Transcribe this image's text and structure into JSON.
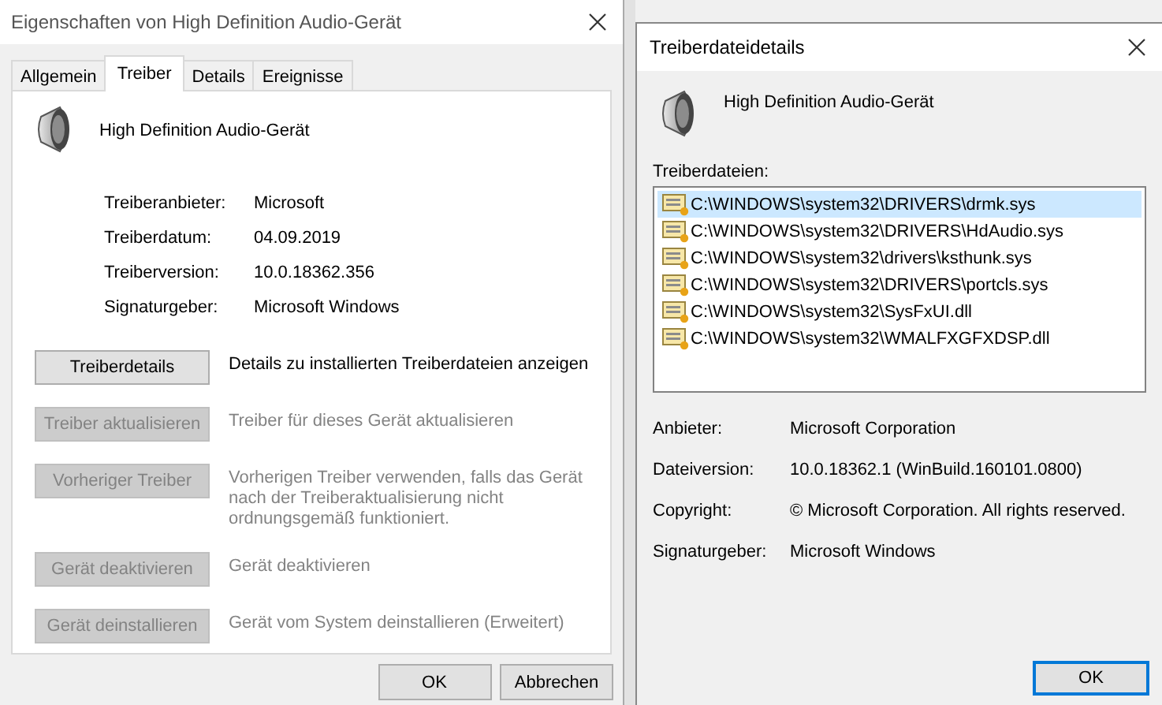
{
  "properties_dialog": {
    "title": "Eigenschaften von High Definition Audio-Gerät",
    "tabs": [
      {
        "label": "Allgemein",
        "selected": false
      },
      {
        "label": "Treiber",
        "selected": true
      },
      {
        "label": "Details",
        "selected": false
      },
      {
        "label": "Ereignisse",
        "selected": false
      }
    ],
    "device_name": "High Definition Audio-Gerät",
    "info": [
      {
        "label": "Treiberanbieter:",
        "value": "Microsoft"
      },
      {
        "label": "Treiberdatum:",
        "value": "04.09.2019"
      },
      {
        "label": "Treiberversion:",
        "value": "10.0.18362.356"
      },
      {
        "label": "Signaturgeber:",
        "value": "Microsoft Windows"
      }
    ],
    "actions": [
      {
        "button": "Treiberdetails",
        "description": "Details zu installierten Treiberdateien anzeigen",
        "disabled": false
      },
      {
        "button": "Treiber aktualisieren",
        "description": "Treiber für dieses Gerät aktualisieren",
        "disabled": true
      },
      {
        "button": "Vorheriger Treiber",
        "description": "Vorherigen Treiber verwenden, falls das Gerät nach der Treiberaktualisierung nicht ordnungsgemäß funktioniert.",
        "disabled": true
      },
      {
        "button": "Gerät deaktivieren",
        "description": "Gerät deaktivieren",
        "disabled": true
      },
      {
        "button": "Gerät deinstallieren",
        "description": "Gerät vom System deinstallieren (Erweitert)",
        "disabled": true
      }
    ],
    "buttons": [
      "OK",
      "Abbrechen"
    ]
  },
  "details_dialog": {
    "title": "Treiberdateidetails",
    "device_name": "High Definition Audio-Gerät",
    "files_label": "Treiberdateien:",
    "files": [
      {
        "path": "C:\\WINDOWS\\system32\\DRIVERS\\drmk.sys",
        "selected": true
      },
      {
        "path": "C:\\WINDOWS\\system32\\DRIVERS\\HdAudio.sys",
        "selected": false
      },
      {
        "path": "C:\\WINDOWS\\system32\\drivers\\ksthunk.sys",
        "selected": false
      },
      {
        "path": "C:\\WINDOWS\\system32\\DRIVERS\\portcls.sys",
        "selected": false
      },
      {
        "path": "C:\\WINDOWS\\system32\\SysFxUI.dll",
        "selected": false
      },
      {
        "path": "C:\\WINDOWS\\system32\\WMALFXGFXDSP.dll",
        "selected": false
      }
    ],
    "info": [
      {
        "label": "Anbieter:",
        "value": "Microsoft Corporation"
      },
      {
        "label": "Dateiversion:",
        "value": "10.0.18362.1 (WinBuild.160101.0800)"
      },
      {
        "label": "Copyright:",
        "value": "© Microsoft Corporation. All rights reserved."
      },
      {
        "label": "Signaturgeber:",
        "value": "Microsoft Windows"
      }
    ],
    "buttons": [
      "OK"
    ]
  }
}
